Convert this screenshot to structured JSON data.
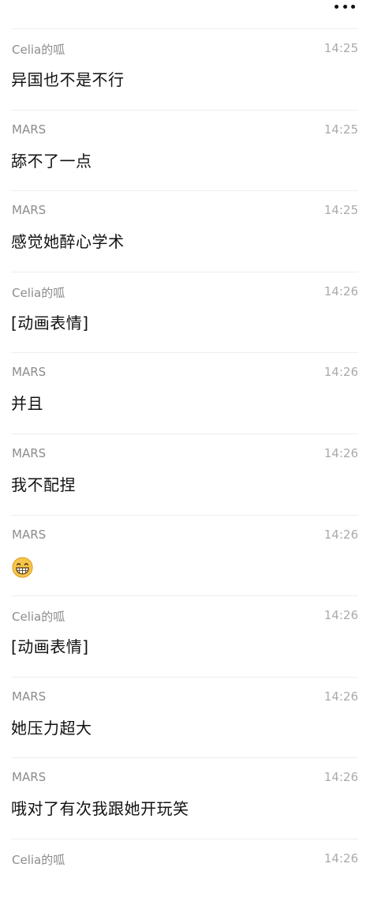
{
  "header": {
    "menu_icon": "more-dots-icon"
  },
  "messages": [
    {
      "sender": "Celia的呱",
      "time": "14:25",
      "text": "异国也不是不行"
    },
    {
      "sender": "MARS",
      "time": "14:25",
      "text": "舔不了一点"
    },
    {
      "sender": "MARS",
      "time": "14:25",
      "text": "感觉她醉心学术"
    },
    {
      "sender": "Celia的呱",
      "time": "14:26",
      "text": "[动画表情]"
    },
    {
      "sender": "MARS",
      "time": "14:26",
      "text": "并且"
    },
    {
      "sender": "MARS",
      "time": "14:26",
      "text": "我不配捏"
    },
    {
      "sender": "MARS",
      "time": "14:26",
      "emoji": "grinning-face-emoji"
    },
    {
      "sender": "Celia的呱",
      "time": "14:26",
      "text": "[动画表情]"
    },
    {
      "sender": "MARS",
      "time": "14:26",
      "text": "她压力超大"
    },
    {
      "sender": "MARS",
      "time": "14:26",
      "text": "哦对了有次我跟她开玩笑"
    },
    {
      "sender": "Celia的呱",
      "time": "14:26",
      "text": ""
    }
  ]
}
